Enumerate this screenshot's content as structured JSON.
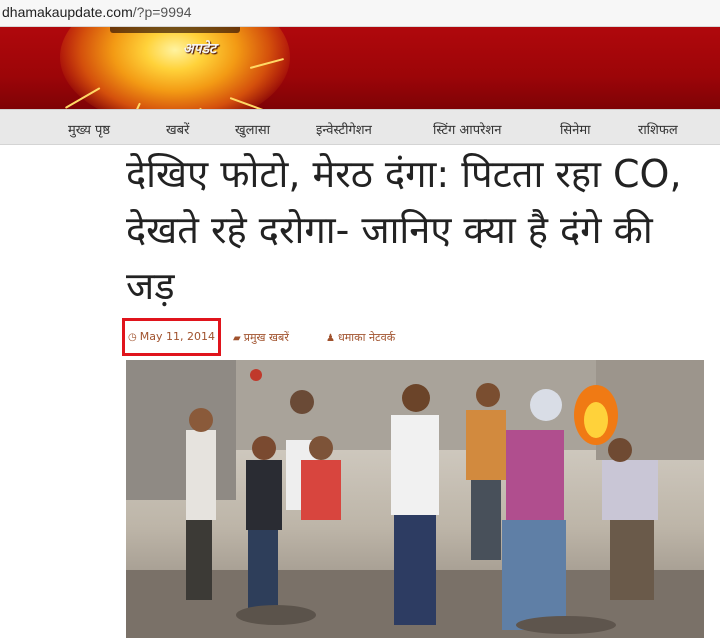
{
  "browser": {
    "url_host": "dhamakaupdate.com",
    "url_path": "/?p=9994"
  },
  "site": {
    "logo_text": "अपडेट"
  },
  "nav": {
    "items": [
      {
        "label": "मुख्य पृष्ठ"
      },
      {
        "label": "खबरें"
      },
      {
        "label": "खुलासा"
      },
      {
        "label": "इन्वेस्टीगेशन"
      },
      {
        "label": "स्टिंग आपरेशन"
      },
      {
        "label": "सिनेमा"
      },
      {
        "label": "राशिफल"
      }
    ]
  },
  "article": {
    "title": "देखिए फोटो, मेरठ दंगा: पिटता रहा CO, देखते रहे दरोगा- जानिए क्या है दंगे की जड़",
    "date": "May 11, 2014",
    "category": "प्रमुख खबरें",
    "author": "धमाका नेटवर्क"
  },
  "colors": {
    "banner_red": "#a8070a",
    "meta_brown": "#a0522d",
    "highlight_red": "#e0141c"
  },
  "icons": {
    "date": "clock-icon",
    "category": "folder-icon",
    "author": "user-icon"
  }
}
